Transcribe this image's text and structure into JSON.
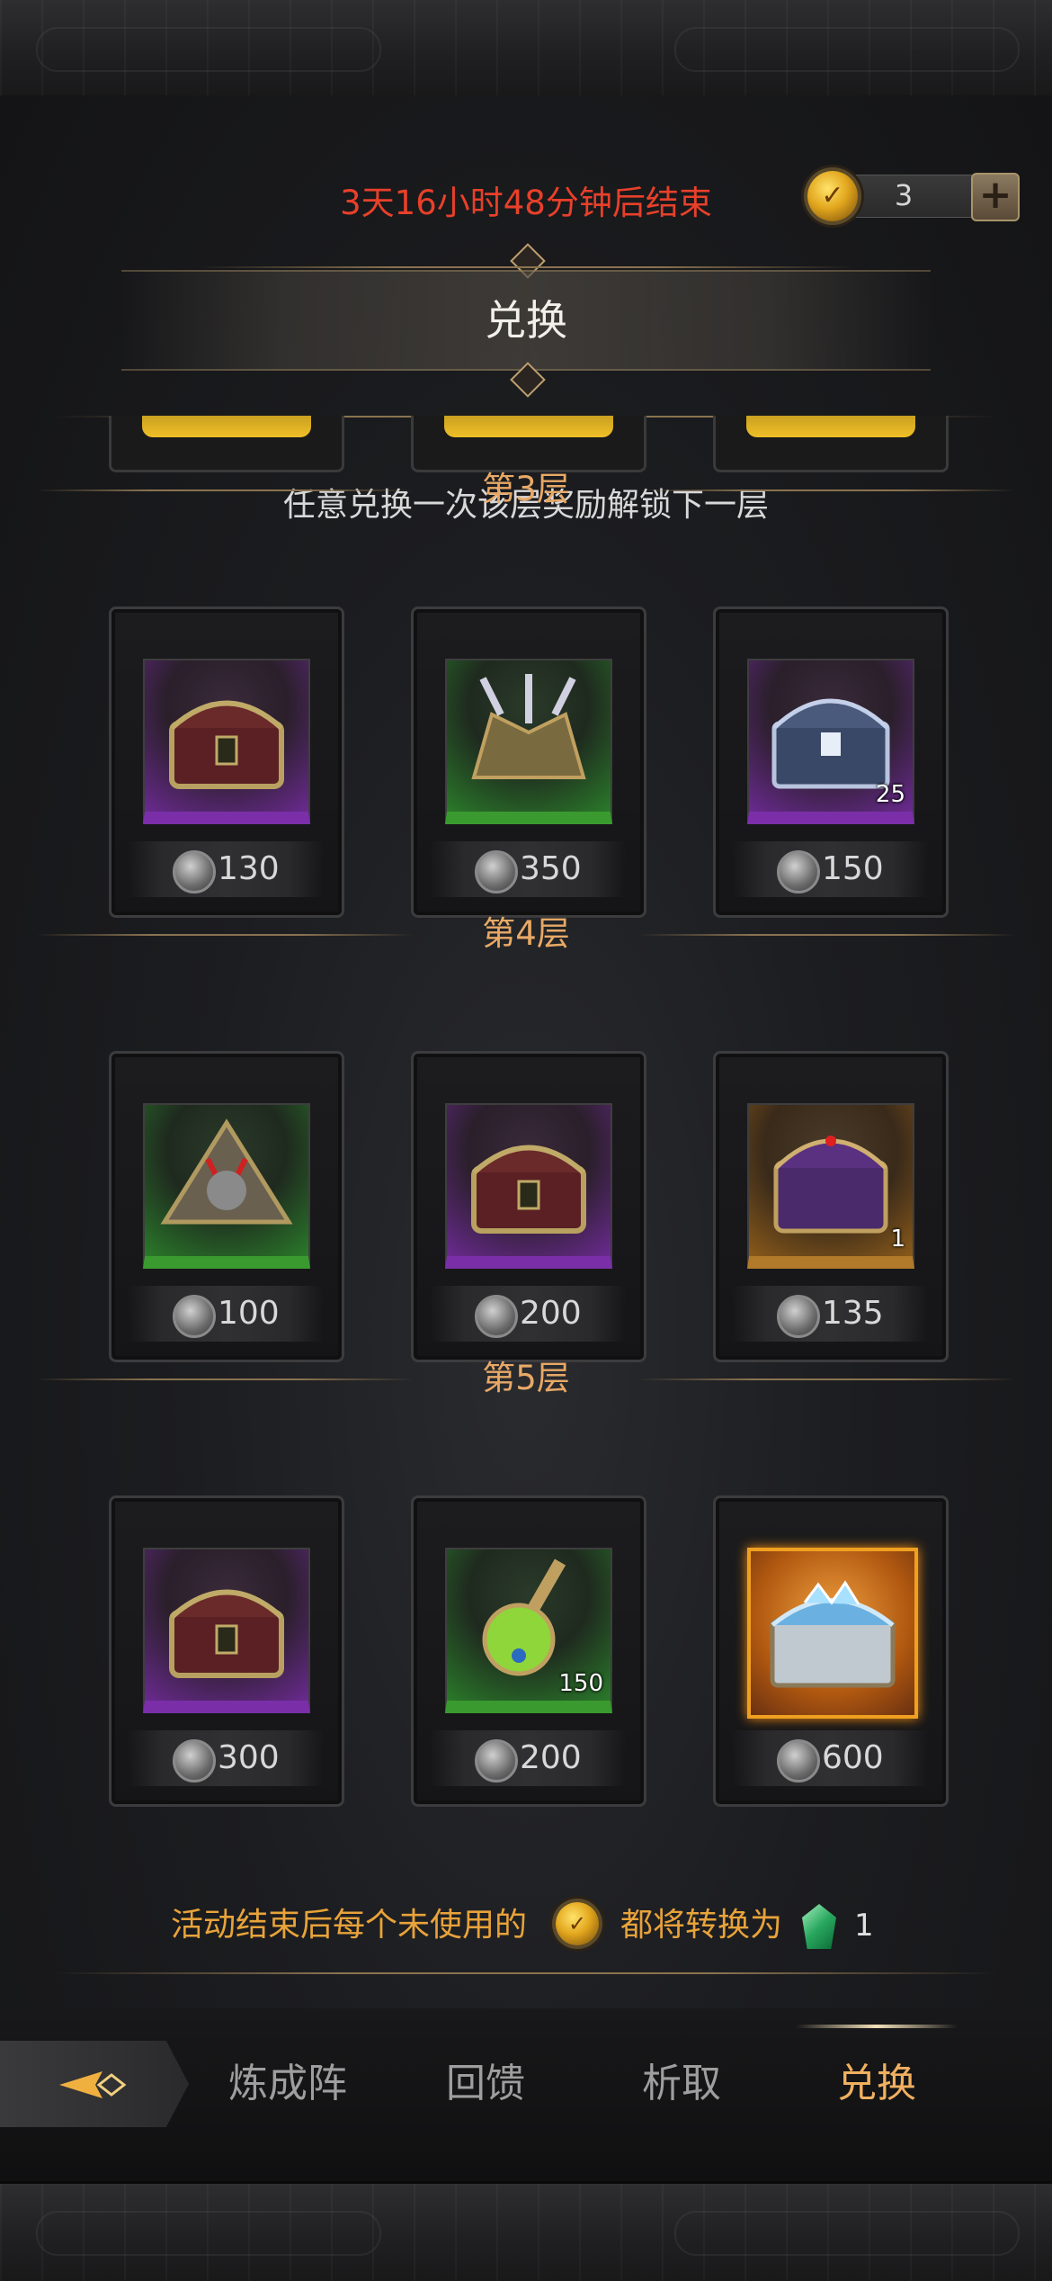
{
  "header": {
    "timer_text": "3天16小时48分钟后结束",
    "currency_count": "3",
    "plus_label": "+"
  },
  "title": "兑换",
  "hint": "任意兑换一次该层奖励解锁下一层",
  "tiers": [
    {
      "label": "第3层",
      "items": [
        {
          "icon": "treasure-chest-icon",
          "rarity": "purple",
          "quantity": "",
          "price": "130"
        },
        {
          "icon": "spiked-armor-chest-icon",
          "rarity": "green",
          "quantity": "",
          "price": "350"
        },
        {
          "icon": "steel-chest-icon",
          "rarity": "purple",
          "quantity": "25",
          "price": "150"
        }
      ]
    },
    {
      "label": "第4层",
      "items": [
        {
          "icon": "pyramid-relic-icon",
          "rarity": "green",
          "quantity": "",
          "price": "100"
        },
        {
          "icon": "treasure-chest-icon",
          "rarity": "purple",
          "quantity": "",
          "price": "200"
        },
        {
          "icon": "dark-armor-chest-icon",
          "rarity": "orange",
          "quantity": "1",
          "price": "135"
        }
      ]
    },
    {
      "label": "第5层",
      "items": [
        {
          "icon": "treasure-chest-icon",
          "rarity": "purple",
          "quantity": "",
          "price": "300"
        },
        {
          "icon": "green-potion-icon",
          "rarity": "green",
          "quantity": "150",
          "price": "200"
        },
        {
          "icon": "crystal-chest-icon",
          "rarity": "legendary",
          "quantity": "",
          "price": "600"
        }
      ]
    }
  ],
  "footer_note": {
    "text_before": "活动结束后每个未使用的",
    "text_middle": "都将转换为",
    "amount": "1"
  },
  "nav": {
    "items": [
      "炼成阵",
      "回馈",
      "析取",
      "兑换"
    ],
    "active_index": 3
  },
  "colors": {
    "timer": "#e8402a",
    "tier_label": "#e8a966",
    "footer_text": "#e8a33a",
    "nav_active": "#f0b060",
    "nav_inactive": "#9e9e9e"
  }
}
